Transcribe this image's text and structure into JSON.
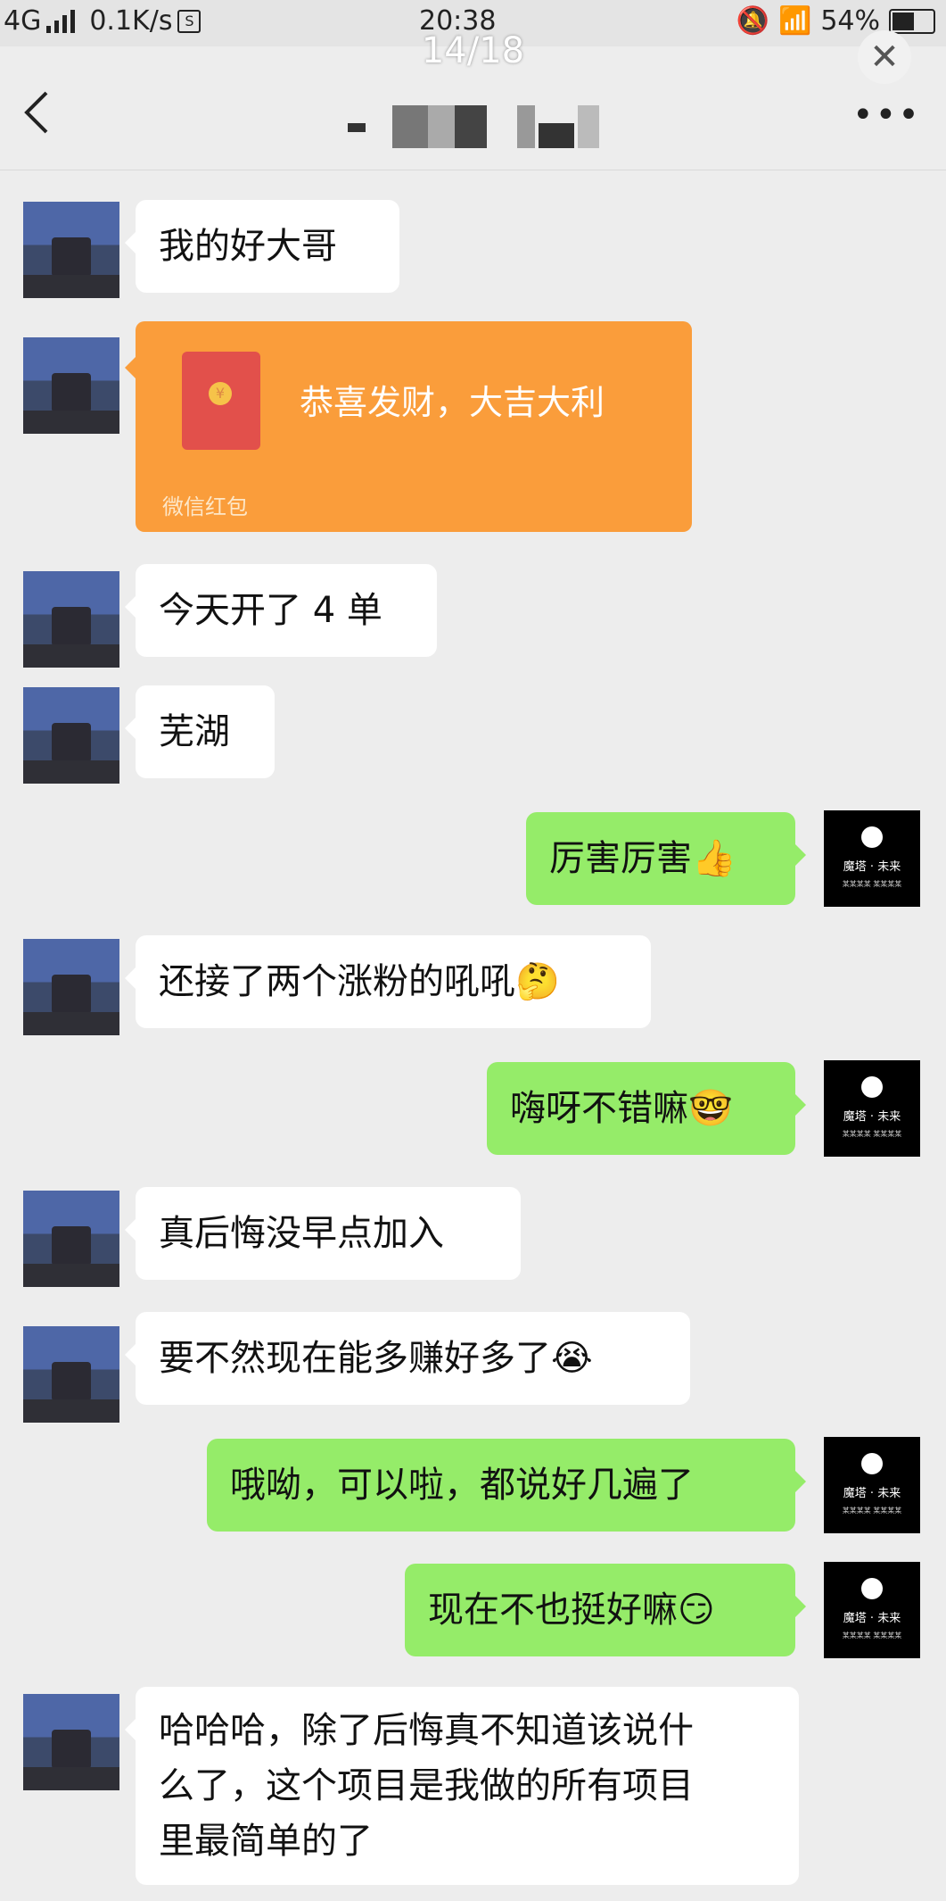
{
  "status_bar": {
    "network": "4G",
    "speed": "0.1K/s",
    "time": "20:38",
    "battery": "54%"
  },
  "viewer": {
    "counter": "14/18",
    "close_icon": "close-icon"
  },
  "chat": {
    "back_icon": "chevron-left-icon",
    "title_censored": true,
    "more_icon": "more-icon"
  },
  "me_avatar": {
    "name": "魔塔 · 未来",
    "sub": "某某某某 某某某某"
  },
  "messages": [
    {
      "side": "left",
      "text": "我的好大哥"
    },
    {
      "side": "left",
      "type": "red_packet",
      "text": "恭喜发财，大吉大利",
      "footer": "微信红包"
    },
    {
      "side": "left",
      "text": "今天开了 4 单"
    },
    {
      "side": "left",
      "text": "芜湖"
    },
    {
      "side": "right",
      "text": "厉害厉害",
      "emoji": "👍"
    },
    {
      "side": "left",
      "text": "还接了两个涨粉的吼吼",
      "emoji": "🤔"
    },
    {
      "side": "right",
      "text": "嗨呀不错嘛",
      "emoji": "🤓"
    },
    {
      "side": "left",
      "text": "真后悔没早点加入"
    },
    {
      "side": "left",
      "text": "要不然现在能多赚好多了",
      "emoji": "😭"
    },
    {
      "side": "right",
      "text": "哦呦，可以啦，都说好几遍了"
    },
    {
      "side": "right",
      "text": "现在不也挺好嘛",
      "emoji": "😏"
    },
    {
      "side": "left",
      "lines": [
        "哈哈哈，除了后悔真不知道该说什",
        "么了，这个项目是我做的所有项目",
        "里最简单的了"
      ]
    }
  ],
  "colors": {
    "background": "#ededed",
    "bubble_me": "#95ec69",
    "bubble_other": "#ffffff",
    "red_packet": "#fa9d3b"
  }
}
